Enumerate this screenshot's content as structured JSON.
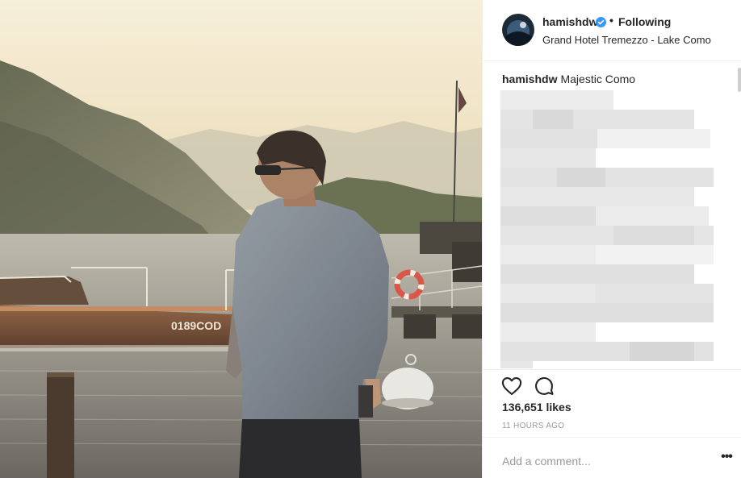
{
  "post": {
    "username": "hamishdw",
    "verified": true,
    "separator": "•",
    "follow_label": "Following",
    "location": "Grand Hotel Tremezzo - Lake Como",
    "caption_user": "hamishdw",
    "caption_text": "Majestic Como",
    "likes": "136,651 likes",
    "time": "11 HOURS AGO",
    "comment_placeholder": "Add a comment...",
    "more_label": "•••"
  },
  "photo": {
    "boat_registration": "0189COD"
  },
  "colors": {
    "verified_blue": "#3897f0",
    "text_dark": "#262626",
    "text_muted": "#999999",
    "divider": "#efefef"
  },
  "icons": {
    "like": "heart-icon",
    "comment": "comment-bubble-icon",
    "verified": "verified-badge-icon",
    "more": "ellipsis-icon"
  }
}
